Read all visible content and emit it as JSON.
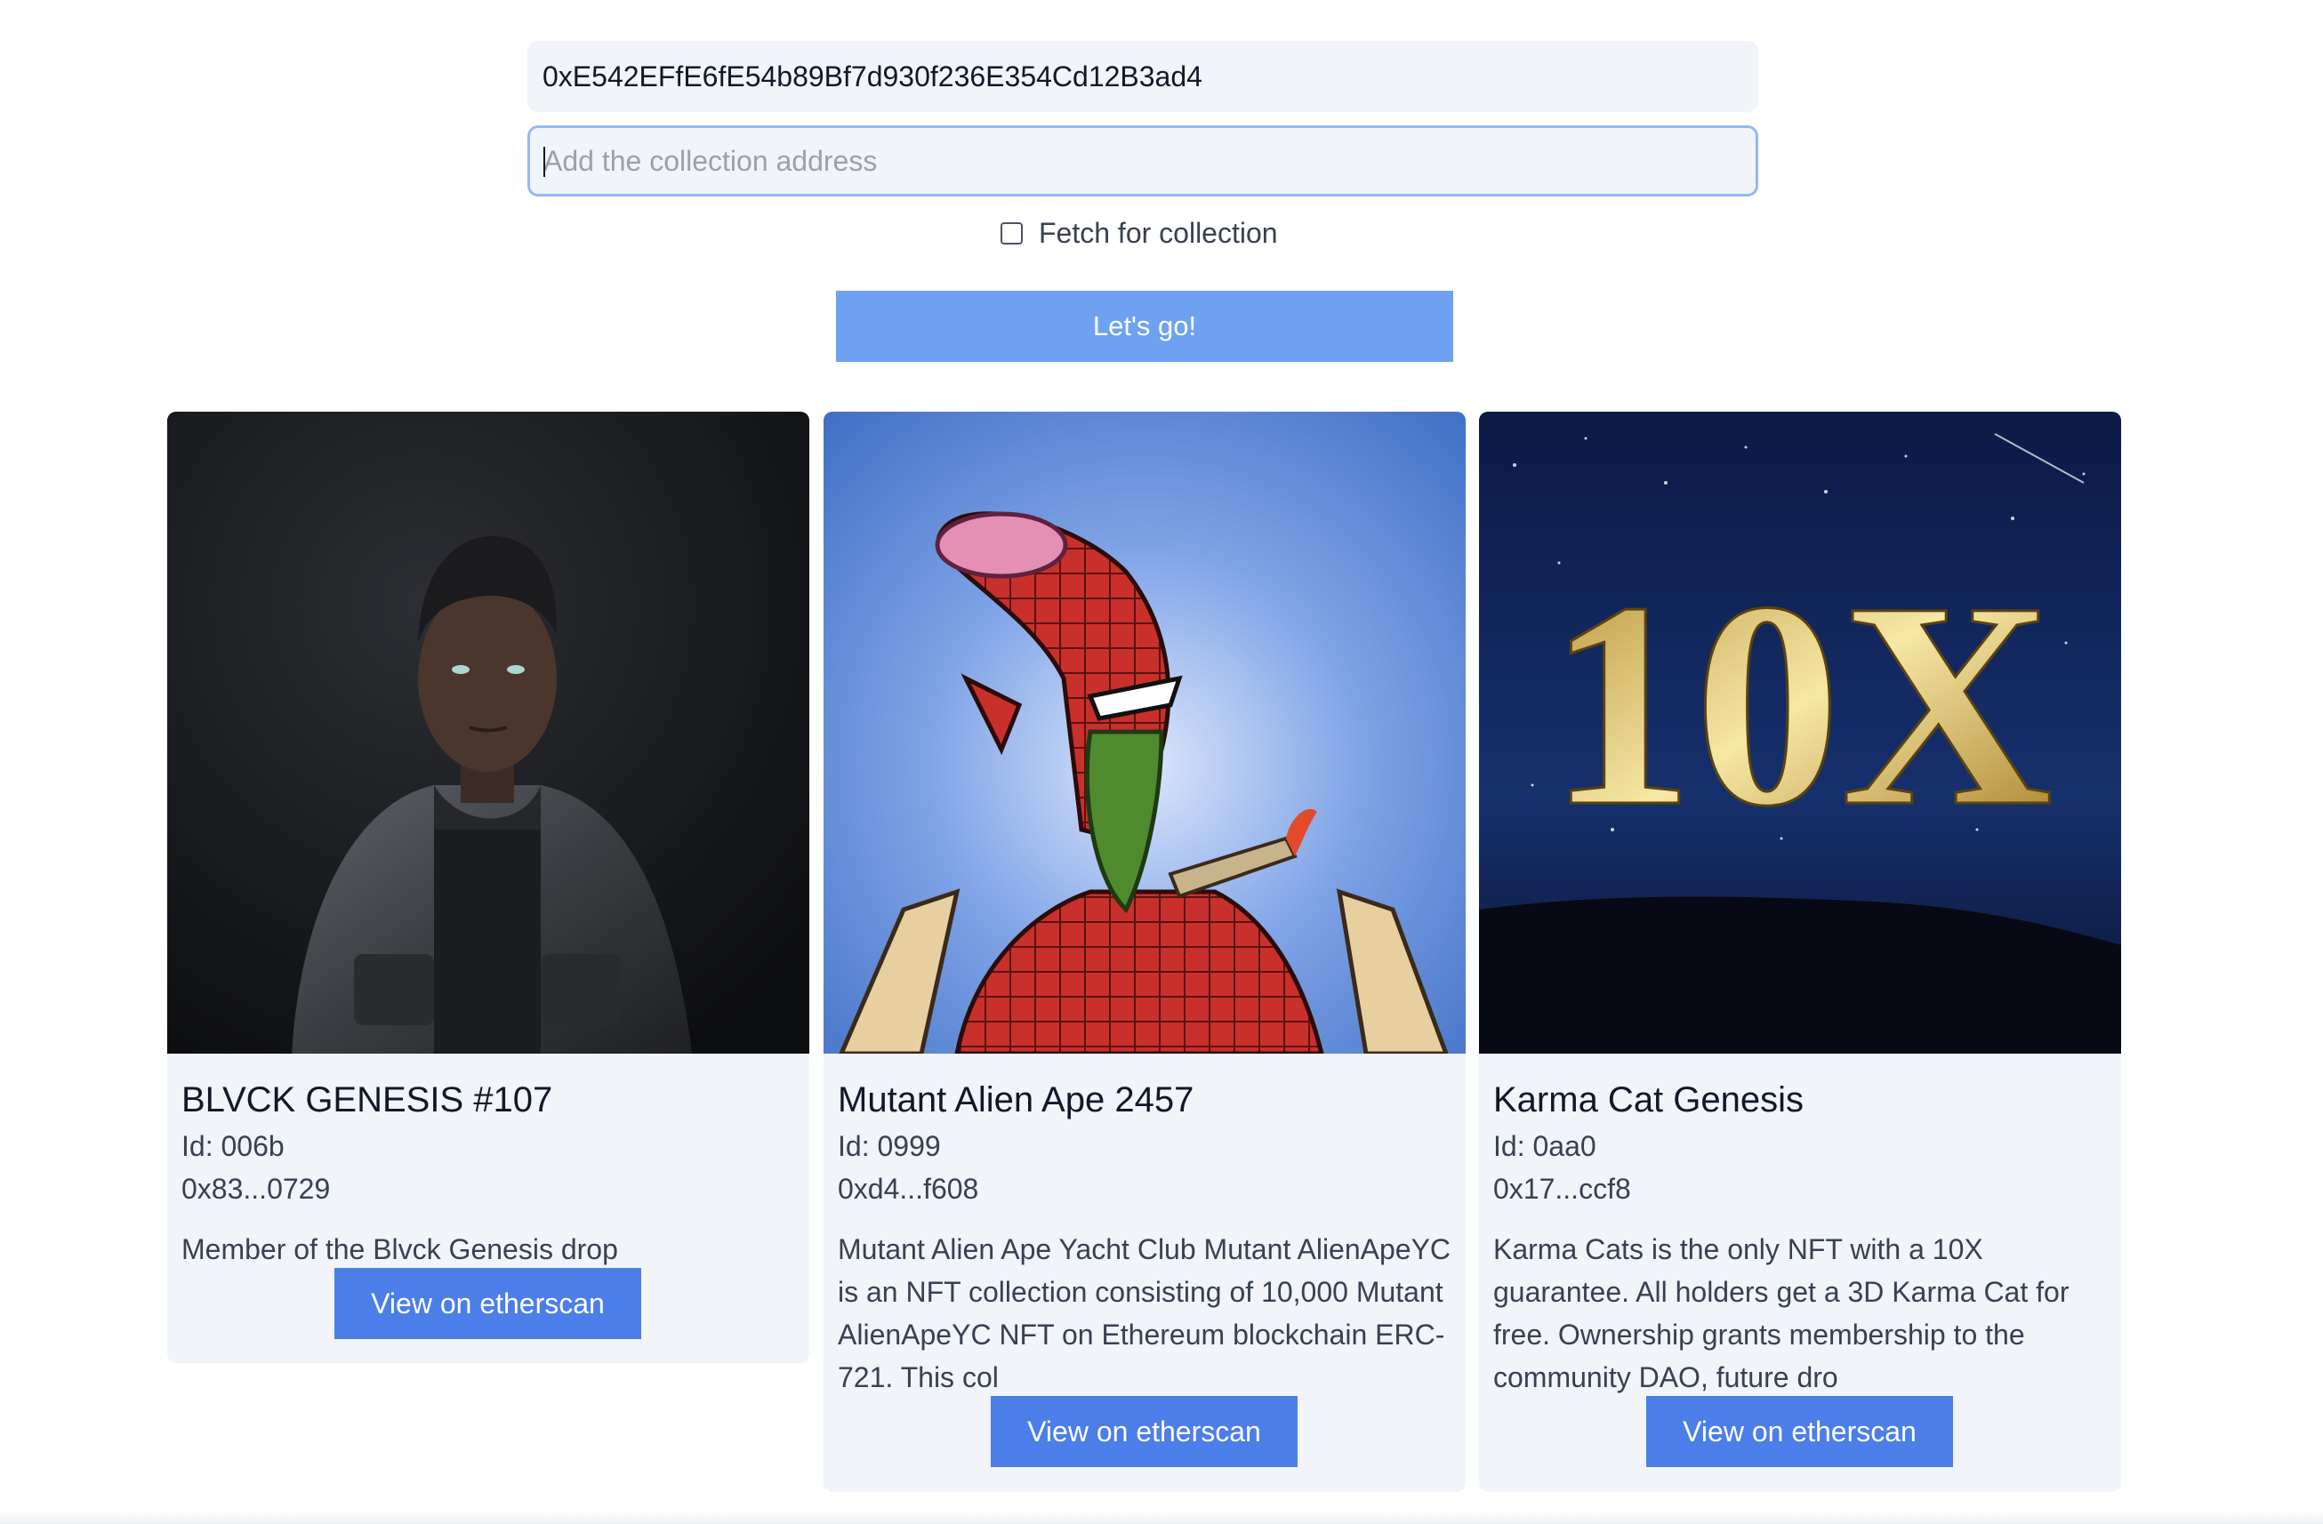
{
  "form": {
    "wallet_value": "0xE542EFfE6fE54b89Bf7d930f236E354Cd12B3ad4",
    "collection_placeholder": "Add the collection address",
    "fetch_label": "Fetch for collection",
    "fetch_checked": false,
    "submit_label": "Let's go!"
  },
  "cards": [
    {
      "title": "BLVCK GENESIS #107",
      "id": "Id: 006b",
      "address": "0x83...0729",
      "description": "Member of the Blvck Genesis drop",
      "button": "View on etherscan"
    },
    {
      "title": "Mutant Alien Ape 2457",
      "id": "Id: 0999",
      "address": "0xd4...f608",
      "description": "Mutant Alien Ape Yacht Club Mutant AlienApeYC is an NFT collection consisting of 10,000 Mutant AlienApeYC NFT on Ethereum blockchain ERC-721. This col",
      "button": "View on etherscan"
    },
    {
      "title": "Karma Cat Genesis",
      "id": "Id: 0aa0",
      "address": "0x17...ccf8",
      "description": "Karma Cats is the only NFT with a 10X guarantee. All holders get a 3D Karma Cat for free. Ownership grants membership to the community DAO, future dro",
      "button": "View on etherscan",
      "image_text": "10X"
    }
  ],
  "colors": {
    "primary_button": "#4b7ee8",
    "submit_button": "#6ea1f2",
    "card_bg": "#f1f4f8",
    "focus_border": "#93b8f5"
  }
}
